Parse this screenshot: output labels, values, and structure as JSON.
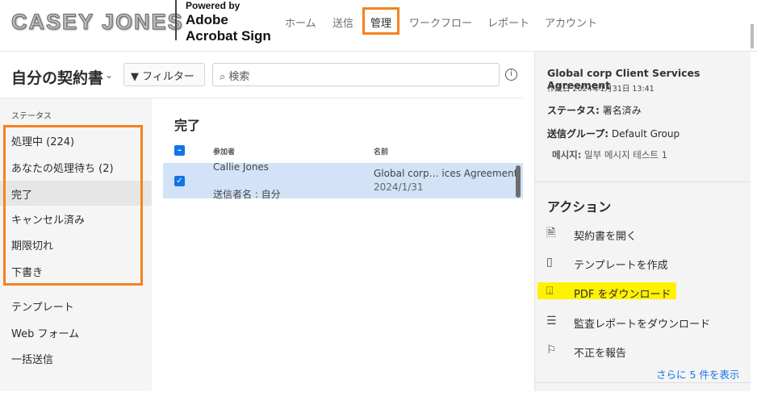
{
  "header": {
    "logo": "CASEY JONES",
    "powered_by": "Powered by",
    "brand_line1": "Adobe",
    "brand_line2": "Acrobat Sign",
    "nav": [
      "ホーム",
      "送信",
      "管理",
      "ワークフロー",
      "レポート",
      "アカウント"
    ],
    "active_nav": "管理"
  },
  "toolbar": {
    "title": "自分の契約書",
    "filter_label": "フィルター",
    "search_placeholder": "検索"
  },
  "sidebar": {
    "section_label": "ステータス",
    "status_items": [
      "処理中 (224)",
      "あなたの処理待ち (2)",
      "完了",
      "キャンセル済み",
      "期限切れ",
      "下書き"
    ],
    "selected": "完了",
    "other_items": [
      "テンプレート",
      "Web フォーム",
      "一括送信"
    ]
  },
  "main": {
    "heading": "完了",
    "columns": {
      "participant": "参加者",
      "name": "名前"
    },
    "rows": [
      {
        "participant": "Callie Jones",
        "sender": "送信者名 : 自分",
        "name": "Global corp… ices Agreement",
        "date": "2024/1/31",
        "checked": true
      }
    ]
  },
  "detail": {
    "title": "Global corp Client Services Agreement",
    "created": "作成日 2024年1月31日 13:41",
    "status_label": "ステータス:",
    "status_value": "署名済み",
    "group_label": "送信グループ:",
    "group_value": "Default Group",
    "message_label": "메시지:",
    "message_value": "일부 메시지 테스트 1",
    "actions_heading": "アクション",
    "actions": [
      {
        "label": "契約書を開く",
        "icon": "document-check-icon"
      },
      {
        "label": "テンプレートを作成",
        "icon": "template-icon"
      },
      {
        "label": "PDF をダウンロード",
        "icon": "pdf-download-icon"
      },
      {
        "label": "監査レポートをダウンロード",
        "icon": "report-download-icon"
      },
      {
        "label": "不正を報告",
        "icon": "flag-icon"
      }
    ],
    "more": "さらに 5 件を表示"
  },
  "colors": {
    "accent": "#1473e6",
    "highlight_box": "#f58220",
    "highlight_marker": "#fff200",
    "selected_row": "#d2e3f7"
  }
}
